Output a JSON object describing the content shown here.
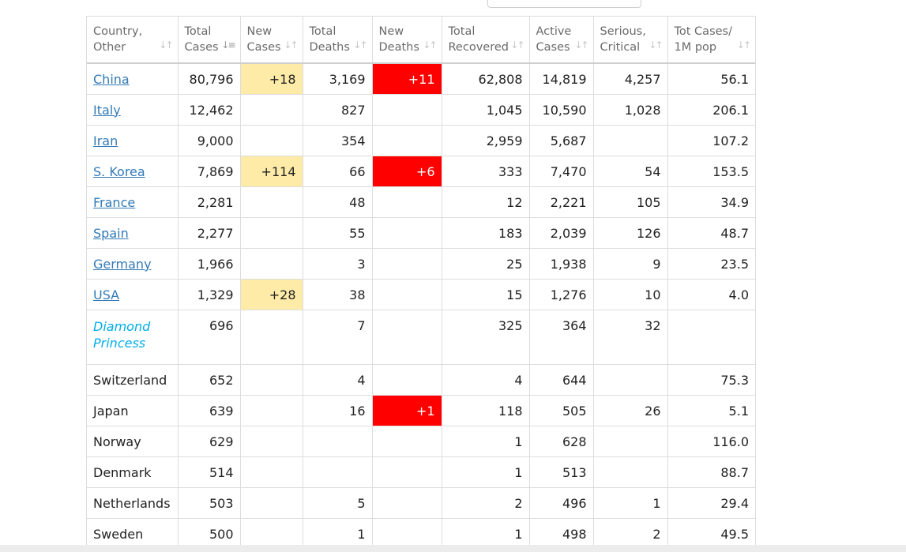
{
  "table": {
    "headers": [
      {
        "line1": "Country,",
        "line2": "Other"
      },
      {
        "line1": "Total",
        "line2": "Cases"
      },
      {
        "line1": "New",
        "line2": "Cases"
      },
      {
        "line1": "Total",
        "line2": "Deaths"
      },
      {
        "line1": "New",
        "line2": "Deaths"
      },
      {
        "line1": "Total",
        "line2": "Recovered"
      },
      {
        "line1": "Active",
        "line2": "Cases"
      },
      {
        "line1": "Serious,",
        "line2": "Critical"
      },
      {
        "line1": "Tot Cases/",
        "line2": "1M pop"
      }
    ],
    "sort_icons": {
      "inactive": "sort-both-icon",
      "active": "sort-descending-icon"
    },
    "rows": [
      {
        "country": "China",
        "link": true,
        "total_cases": "80,796",
        "new_cases": "+18",
        "total_deaths": "3,169",
        "new_deaths": "+11",
        "total_recovered": "62,808",
        "active_cases": "14,819",
        "serious": "4,257",
        "per_million": "56.1"
      },
      {
        "country": "Italy",
        "link": true,
        "total_cases": "12,462",
        "new_cases": "",
        "total_deaths": "827",
        "new_deaths": "",
        "total_recovered": "1,045",
        "active_cases": "10,590",
        "serious": "1,028",
        "per_million": "206.1"
      },
      {
        "country": "Iran",
        "link": true,
        "total_cases": "9,000",
        "new_cases": "",
        "total_deaths": "354",
        "new_deaths": "",
        "total_recovered": "2,959",
        "active_cases": "5,687",
        "serious": "",
        "per_million": "107.2"
      },
      {
        "country": "S. Korea",
        "link": true,
        "total_cases": "7,869",
        "new_cases": "+114",
        "total_deaths": "66",
        "new_deaths": "+6",
        "total_recovered": "333",
        "active_cases": "7,470",
        "serious": "54",
        "per_million": "153.5"
      },
      {
        "country": "France",
        "link": true,
        "total_cases": "2,281",
        "new_cases": "",
        "total_deaths": "48",
        "new_deaths": "",
        "total_recovered": "12",
        "active_cases": "2,221",
        "serious": "105",
        "per_million": "34.9"
      },
      {
        "country": "Spain",
        "link": true,
        "total_cases": "2,277",
        "new_cases": "",
        "total_deaths": "55",
        "new_deaths": "",
        "total_recovered": "183",
        "active_cases": "2,039",
        "serious": "126",
        "per_million": "48.7"
      },
      {
        "country": "Germany",
        "link": true,
        "total_cases": "1,966",
        "new_cases": "",
        "total_deaths": "3",
        "new_deaths": "",
        "total_recovered": "25",
        "active_cases": "1,938",
        "serious": "9",
        "per_million": "23.5"
      },
      {
        "country": "USA",
        "link": true,
        "total_cases": "1,329",
        "new_cases": "+28",
        "total_deaths": "38",
        "new_deaths": "",
        "total_recovered": "15",
        "active_cases": "1,276",
        "serious": "10",
        "per_million": "4.0"
      },
      {
        "country_line1": "Diamond",
        "country_line2": "Princess",
        "ship": true,
        "total_cases": "696",
        "new_cases": "",
        "total_deaths": "7",
        "new_deaths": "",
        "total_recovered": "325",
        "active_cases": "364",
        "serious": "32",
        "per_million": ""
      },
      {
        "country": "Switzerland",
        "link": false,
        "total_cases": "652",
        "new_cases": "",
        "total_deaths": "4",
        "new_deaths": "",
        "total_recovered": "4",
        "active_cases": "644",
        "serious": "",
        "per_million": "75.3"
      },
      {
        "country": "Japan",
        "link": false,
        "total_cases": "639",
        "new_cases": "",
        "total_deaths": "16",
        "new_deaths": "+1",
        "total_recovered": "118",
        "active_cases": "505",
        "serious": "26",
        "per_million": "5.1"
      },
      {
        "country": "Norway",
        "link": false,
        "total_cases": "629",
        "new_cases": "",
        "total_deaths": "",
        "new_deaths": "",
        "total_recovered": "1",
        "active_cases": "628",
        "serious": "",
        "per_million": "116.0"
      },
      {
        "country": "Denmark",
        "link": false,
        "total_cases": "514",
        "new_cases": "",
        "total_deaths": "",
        "new_deaths": "",
        "total_recovered": "1",
        "active_cases": "513",
        "serious": "",
        "per_million": "88.7"
      },
      {
        "country": "Netherlands",
        "link": false,
        "total_cases": "503",
        "new_cases": "",
        "total_deaths": "5",
        "new_deaths": "",
        "total_recovered": "2",
        "active_cases": "496",
        "serious": "1",
        "per_million": "29.4"
      },
      {
        "country": "Sweden",
        "link": false,
        "total_cases": "500",
        "new_cases": "",
        "total_deaths": "1",
        "new_deaths": "",
        "total_recovered": "1",
        "active_cases": "498",
        "serious": "2",
        "per_million": "49.5"
      }
    ]
  }
}
